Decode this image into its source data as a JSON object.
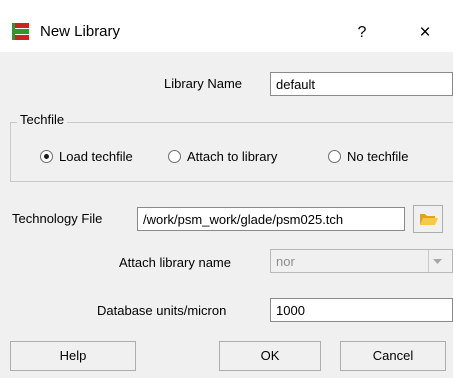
{
  "window": {
    "title": "New Library",
    "help_button": "?",
    "close_button": "×"
  },
  "library_name": {
    "label": "Library Name",
    "value": "default"
  },
  "techfile": {
    "group_label": "Techfile",
    "options": [
      {
        "label": "Load techfile",
        "selected": true
      },
      {
        "label": "Attach to library",
        "selected": false
      },
      {
        "label": "No techfile",
        "selected": false
      }
    ]
  },
  "technology_file": {
    "label": "Technology File",
    "value": "/work/psm_work/glade/psm025.tch"
  },
  "attach_library": {
    "label": "Attach library name",
    "value": "nor",
    "enabled": false
  },
  "database_units": {
    "label": "Database units/micron",
    "value": "1000"
  },
  "buttons": {
    "help": "Help",
    "ok": "OK",
    "cancel": "Cancel"
  },
  "colors": {
    "app_icon_red": "#cc2222",
    "app_icon_green": "#2a9a2a",
    "folder_icon": "#f0b428"
  }
}
